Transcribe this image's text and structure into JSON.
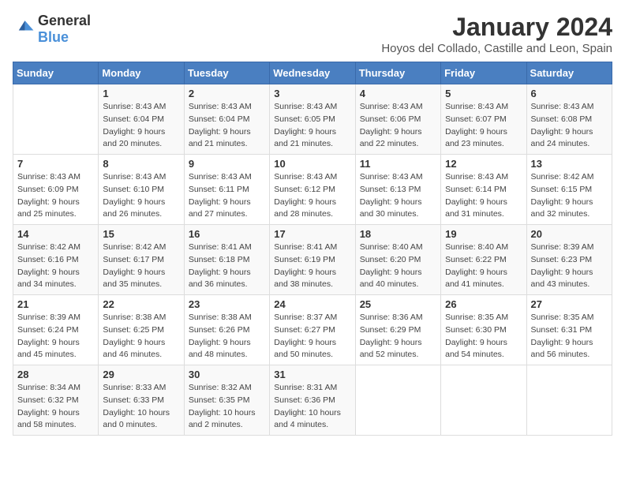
{
  "logo": {
    "general": "General",
    "blue": "Blue"
  },
  "title": "January 2024",
  "location": "Hoyos del Collado, Castille and Leon, Spain",
  "days_of_week": [
    "Sunday",
    "Monday",
    "Tuesday",
    "Wednesday",
    "Thursday",
    "Friday",
    "Saturday"
  ],
  "weeks": [
    [
      {
        "day": "",
        "sunrise": "",
        "sunset": "",
        "daylight": ""
      },
      {
        "day": "1",
        "sunrise": "Sunrise: 8:43 AM",
        "sunset": "Sunset: 6:04 PM",
        "daylight": "Daylight: 9 hours and 20 minutes."
      },
      {
        "day": "2",
        "sunrise": "Sunrise: 8:43 AM",
        "sunset": "Sunset: 6:04 PM",
        "daylight": "Daylight: 9 hours and 21 minutes."
      },
      {
        "day": "3",
        "sunrise": "Sunrise: 8:43 AM",
        "sunset": "Sunset: 6:05 PM",
        "daylight": "Daylight: 9 hours and 21 minutes."
      },
      {
        "day": "4",
        "sunrise": "Sunrise: 8:43 AM",
        "sunset": "Sunset: 6:06 PM",
        "daylight": "Daylight: 9 hours and 22 minutes."
      },
      {
        "day": "5",
        "sunrise": "Sunrise: 8:43 AM",
        "sunset": "Sunset: 6:07 PM",
        "daylight": "Daylight: 9 hours and 23 minutes."
      },
      {
        "day": "6",
        "sunrise": "Sunrise: 8:43 AM",
        "sunset": "Sunset: 6:08 PM",
        "daylight": "Daylight: 9 hours and 24 minutes."
      }
    ],
    [
      {
        "day": "7",
        "sunrise": "Sunrise: 8:43 AM",
        "sunset": "Sunset: 6:09 PM",
        "daylight": "Daylight: 9 hours and 25 minutes."
      },
      {
        "day": "8",
        "sunrise": "Sunrise: 8:43 AM",
        "sunset": "Sunset: 6:10 PM",
        "daylight": "Daylight: 9 hours and 26 minutes."
      },
      {
        "day": "9",
        "sunrise": "Sunrise: 8:43 AM",
        "sunset": "Sunset: 6:11 PM",
        "daylight": "Daylight: 9 hours and 27 minutes."
      },
      {
        "day": "10",
        "sunrise": "Sunrise: 8:43 AM",
        "sunset": "Sunset: 6:12 PM",
        "daylight": "Daylight: 9 hours and 28 minutes."
      },
      {
        "day": "11",
        "sunrise": "Sunrise: 8:43 AM",
        "sunset": "Sunset: 6:13 PM",
        "daylight": "Daylight: 9 hours and 30 minutes."
      },
      {
        "day": "12",
        "sunrise": "Sunrise: 8:43 AM",
        "sunset": "Sunset: 6:14 PM",
        "daylight": "Daylight: 9 hours and 31 minutes."
      },
      {
        "day": "13",
        "sunrise": "Sunrise: 8:42 AM",
        "sunset": "Sunset: 6:15 PM",
        "daylight": "Daylight: 9 hours and 32 minutes."
      }
    ],
    [
      {
        "day": "14",
        "sunrise": "Sunrise: 8:42 AM",
        "sunset": "Sunset: 6:16 PM",
        "daylight": "Daylight: 9 hours and 34 minutes."
      },
      {
        "day": "15",
        "sunrise": "Sunrise: 8:42 AM",
        "sunset": "Sunset: 6:17 PM",
        "daylight": "Daylight: 9 hours and 35 minutes."
      },
      {
        "day": "16",
        "sunrise": "Sunrise: 8:41 AM",
        "sunset": "Sunset: 6:18 PM",
        "daylight": "Daylight: 9 hours and 36 minutes."
      },
      {
        "day": "17",
        "sunrise": "Sunrise: 8:41 AM",
        "sunset": "Sunset: 6:19 PM",
        "daylight": "Daylight: 9 hours and 38 minutes."
      },
      {
        "day": "18",
        "sunrise": "Sunrise: 8:40 AM",
        "sunset": "Sunset: 6:20 PM",
        "daylight": "Daylight: 9 hours and 40 minutes."
      },
      {
        "day": "19",
        "sunrise": "Sunrise: 8:40 AM",
        "sunset": "Sunset: 6:22 PM",
        "daylight": "Daylight: 9 hours and 41 minutes."
      },
      {
        "day": "20",
        "sunrise": "Sunrise: 8:39 AM",
        "sunset": "Sunset: 6:23 PM",
        "daylight": "Daylight: 9 hours and 43 minutes."
      }
    ],
    [
      {
        "day": "21",
        "sunrise": "Sunrise: 8:39 AM",
        "sunset": "Sunset: 6:24 PM",
        "daylight": "Daylight: 9 hours and 45 minutes."
      },
      {
        "day": "22",
        "sunrise": "Sunrise: 8:38 AM",
        "sunset": "Sunset: 6:25 PM",
        "daylight": "Daylight: 9 hours and 46 minutes."
      },
      {
        "day": "23",
        "sunrise": "Sunrise: 8:38 AM",
        "sunset": "Sunset: 6:26 PM",
        "daylight": "Daylight: 9 hours and 48 minutes."
      },
      {
        "day": "24",
        "sunrise": "Sunrise: 8:37 AM",
        "sunset": "Sunset: 6:27 PM",
        "daylight": "Daylight: 9 hours and 50 minutes."
      },
      {
        "day": "25",
        "sunrise": "Sunrise: 8:36 AM",
        "sunset": "Sunset: 6:29 PM",
        "daylight": "Daylight: 9 hours and 52 minutes."
      },
      {
        "day": "26",
        "sunrise": "Sunrise: 8:35 AM",
        "sunset": "Sunset: 6:30 PM",
        "daylight": "Daylight: 9 hours and 54 minutes."
      },
      {
        "day": "27",
        "sunrise": "Sunrise: 8:35 AM",
        "sunset": "Sunset: 6:31 PM",
        "daylight": "Daylight: 9 hours and 56 minutes."
      }
    ],
    [
      {
        "day": "28",
        "sunrise": "Sunrise: 8:34 AM",
        "sunset": "Sunset: 6:32 PM",
        "daylight": "Daylight: 9 hours and 58 minutes."
      },
      {
        "day": "29",
        "sunrise": "Sunrise: 8:33 AM",
        "sunset": "Sunset: 6:33 PM",
        "daylight": "Daylight: 10 hours and 0 minutes."
      },
      {
        "day": "30",
        "sunrise": "Sunrise: 8:32 AM",
        "sunset": "Sunset: 6:35 PM",
        "daylight": "Daylight: 10 hours and 2 minutes."
      },
      {
        "day": "31",
        "sunrise": "Sunrise: 8:31 AM",
        "sunset": "Sunset: 6:36 PM",
        "daylight": "Daylight: 10 hours and 4 minutes."
      },
      {
        "day": "",
        "sunrise": "",
        "sunset": "",
        "daylight": ""
      },
      {
        "day": "",
        "sunrise": "",
        "sunset": "",
        "daylight": ""
      },
      {
        "day": "",
        "sunrise": "",
        "sunset": "",
        "daylight": ""
      }
    ]
  ]
}
